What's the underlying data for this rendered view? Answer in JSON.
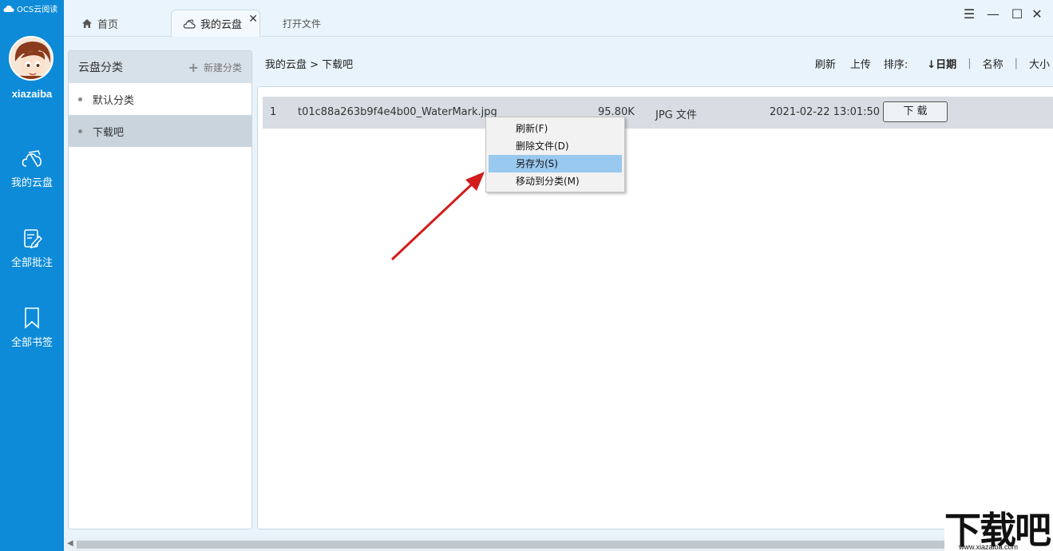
{
  "app": {
    "title": "OCS云阅读",
    "username": "xiazaiba"
  },
  "rail": {
    "items": [
      {
        "label": "我的云盘",
        "icon": "cloud-icon"
      },
      {
        "label": "全部批注",
        "icon": "note-edit-icon"
      },
      {
        "label": "全部书签",
        "icon": "bookmark-icon"
      }
    ]
  },
  "tabs": [
    {
      "label": "首页",
      "icon": "home-icon"
    },
    {
      "label": "我的云盘",
      "icon": "cloud-icon",
      "active": true
    },
    {
      "label": "打开文件"
    }
  ],
  "window_controls": {
    "menu": "☰",
    "minimize": "—",
    "maximize": "☐",
    "close": "✕"
  },
  "categories": {
    "header": "云盘分类",
    "new_button": "新建分类",
    "items": [
      {
        "label": "默认分类"
      },
      {
        "label": "下载吧",
        "active": true
      }
    ]
  },
  "breadcrumb": "我的云盘 > 下载吧",
  "toolbar": {
    "refresh": "刷新",
    "upload": "上传",
    "sort_label": "排序:",
    "sort_date": "↓日期",
    "sort_name": "名称",
    "sort_size": "大小"
  },
  "files": [
    {
      "index": "1",
      "name": "t01c88a263b9f4e4b00_WaterMark.jpg",
      "size": "95.80K",
      "type": "JPG 文件",
      "date": "2021-02-22 13:01:50",
      "download": "下载"
    }
  ],
  "context_menu": {
    "items": [
      {
        "label": "刷新(F)"
      },
      {
        "label": "删除文件(D)"
      },
      {
        "label": "另存为(S)",
        "highlighted": true
      },
      {
        "label": "移动到分类(M)"
      }
    ]
  },
  "watermark": {
    "logo": "下载吧",
    "url": "www.xiazaiba.com"
  },
  "colors": {
    "rail": "#0d8bd8",
    "highlight": "#99c9ef",
    "arrow": "#d21c1c"
  }
}
